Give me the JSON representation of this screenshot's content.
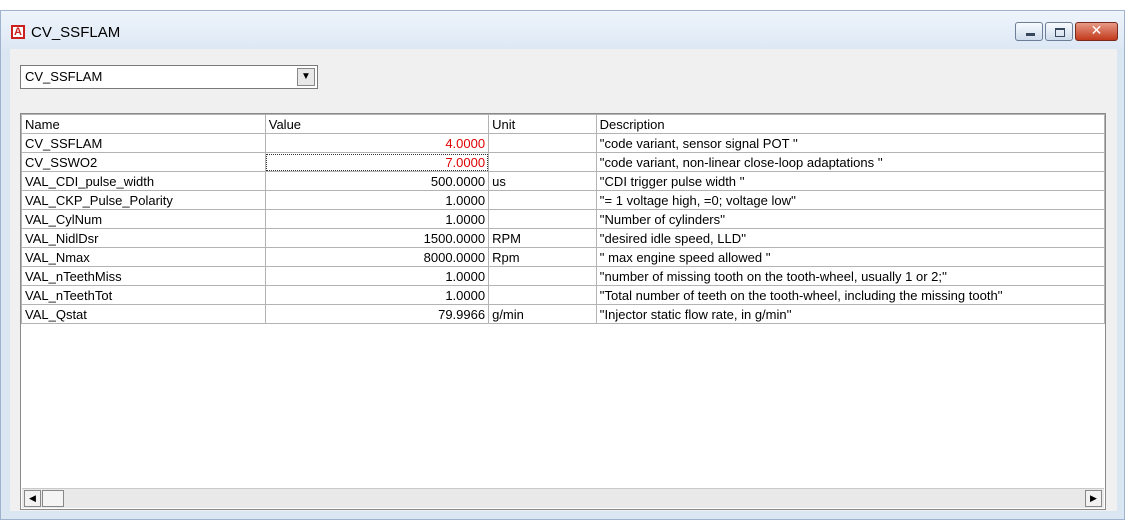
{
  "window": {
    "title": "CV_SSFLAM",
    "close_glyph": "✕"
  },
  "selector": {
    "value": "CV_SSFLAM",
    "arrow_glyph": "▼"
  },
  "table": {
    "columns": [
      "Name",
      "Value",
      "Unit",
      "Description"
    ],
    "rows": [
      {
        "name": "CV_SSFLAM",
        "value": "4.0000",
        "unit": "",
        "description": "''code variant, sensor signal POT ''"
      },
      {
        "name": "CV_SSWO2",
        "value": "7.0000",
        "unit": "",
        "description": "''code variant, non-linear close-loop adaptations ''"
      },
      {
        "name": "VAL_CDI_pulse_width",
        "value": "500.0000",
        "unit": "us",
        "description": "''CDI trigger pulse width ''"
      },
      {
        "name": "VAL_CKP_Pulse_Polarity",
        "value": "1.0000",
        "unit": "",
        "description": "''= 1 voltage high, =0; voltage low''"
      },
      {
        "name": "VAL_CylNum",
        "value": "1.0000",
        "unit": "",
        "description": "''Number of cylinders''"
      },
      {
        "name": "VAL_NidlDsr",
        "value": "1500.0000",
        "unit": "RPM",
        "description": "''desired idle speed, LLD''"
      },
      {
        "name": "VAL_Nmax",
        "value": "8000.0000",
        "unit": "Rpm",
        "description": "'' max engine speed allowed ''"
      },
      {
        "name": "VAL_nTeethMiss",
        "value": "1.0000",
        "unit": "",
        "description": "''number of missing tooth on the tooth-wheel, usually 1 or 2;''"
      },
      {
        "name": "VAL_nTeethTot",
        "value": "1.0000",
        "unit": "",
        "description": "''Total number of teeth on the tooth-wheel, including the missing tooth''"
      },
      {
        "name": "VAL_Qstat",
        "value": "79.9966",
        "unit": "g/min",
        "description": "''Injector static flow rate, in g/min''"
      }
    ]
  },
  "scrollbar": {
    "left_glyph": "◀",
    "right_glyph": "▶"
  },
  "colors": {
    "modified_value": "#e00000",
    "window_frame": "#dbe6f3"
  }
}
